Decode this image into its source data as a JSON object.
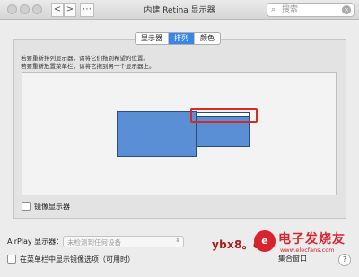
{
  "window": {
    "title": "内建 Retina 显示器",
    "back_label": "<",
    "forward_label": ">",
    "grid_label": "⋯"
  },
  "search": {
    "placeholder": "搜索",
    "icon": "magnifier-icon",
    "clear": "×"
  },
  "tabs": [
    {
      "label": "显示器",
      "active": false
    },
    {
      "label": "排列",
      "active": true
    },
    {
      "label": "颜色",
      "active": false
    }
  ],
  "instructions": {
    "line1": "若要重新排列显示器，请将它们拖到希望的位置。",
    "line2": "若要重新放置菜单栏，请将它拖到另一个显示器上。"
  },
  "mirror": {
    "label": "镜像显示器",
    "checked": false
  },
  "airplay": {
    "label": "AirPlay 显示器：",
    "value": "未检测到任何设备"
  },
  "menubar_option": {
    "label": "在菜单栏中显示镜像选项（可用时）",
    "checked": false
  },
  "buttons": {
    "gather": "集合窗口",
    "help": "?"
  },
  "watermark": "ybx8。cn",
  "logo": {
    "mark": "e",
    "main": "电子发烧友",
    "sub": "www.elecfans.com"
  },
  "colors": {
    "display_fill": "#5b8fd5",
    "highlight": "#d42b26",
    "active_tab": "#3a86e6"
  }
}
